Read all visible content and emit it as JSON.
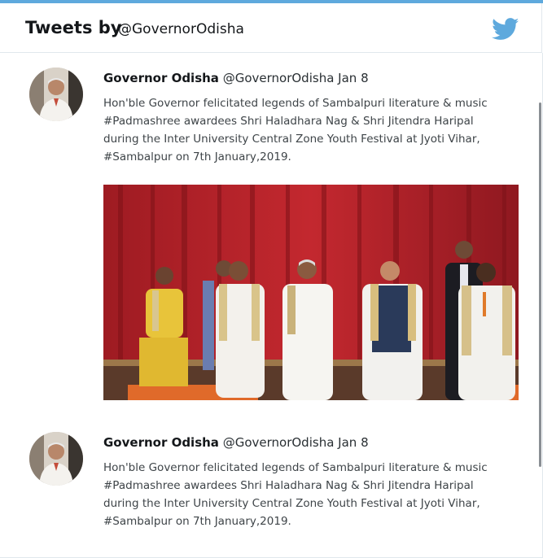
{
  "header": {
    "title": "Tweets by",
    "handle": "@GovernorOdisha",
    "twitter_icon": "twitter-bird-icon",
    "accent": "#5ea9dd"
  },
  "tweets": [
    {
      "author_name": "Governor Odisha",
      "author_handle": "@GovernorOdisha",
      "date": "Jan 8",
      "lines": [
        "Hon'ble Governor felicitated legends of Sambalpuri literature & music",
        "#Padmashree awardees Shri Haladhara Nag & Shri  Jitendra Haripal",
        "during the  Inter University Central Zone Youth Festival at Jyoti Vihar,",
        "#Sambalpur on 7th January,2019."
      ],
      "has_media": true
    },
    {
      "author_name": "Governor Odisha",
      "author_handle": "@GovernorOdisha",
      "date": "Jan 8",
      "lines": [
        "Hon'ble Governor felicitated legends of Sambalpuri literature & music",
        "#Padmashree awardees Shri Haladhara Nag & Shri  Jitendra Haripal",
        "during the  Inter University Central Zone Youth Festival at Jyoti Vihar,",
        "#Sambalpur on 7th January,2019."
      ],
      "has_media": false
    }
  ]
}
